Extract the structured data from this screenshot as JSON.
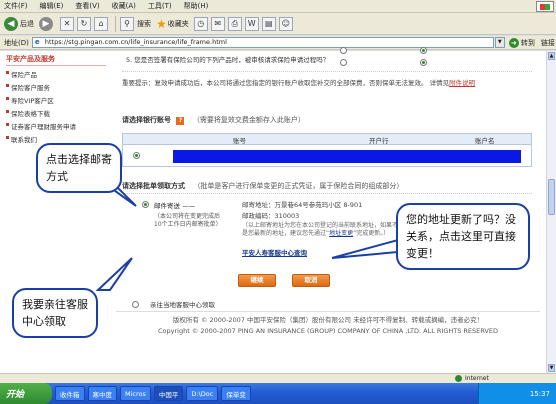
{
  "browser": {
    "menu": [
      "文件(F)",
      "编辑(E)",
      "查看(V)",
      "收藏(A)",
      "工具(T)",
      "帮助(H)"
    ],
    "toolbar": {
      "back_label": "后退",
      "search_label": "搜索",
      "favorites_label": "收藏夹"
    },
    "address_label": "地址(D)",
    "address_url": "https://stg.pingan.com.cn/life_insurance/life_frame.html",
    "go_label": "转到",
    "links_label": "链接"
  },
  "sidebar": {
    "title": "平安产品及服务",
    "items": [
      {
        "label": "保险产品"
      },
      {
        "label": "保险客户服务"
      },
      {
        "label": "寿险VIP客户区"
      },
      {
        "label": "保险表格下载"
      },
      {
        "label": "证券客户理财服务申请"
      },
      {
        "label": "联系我们"
      }
    ]
  },
  "form": {
    "question_5": "5. 您是否签署有保险公司的下列产品时，被审核请求保险申请过程吗？",
    "notice_text": "重要提示：复效申请成功后，本公司将通过您指定的银行账户收取您补交的全部保费，否则保单无法复效。",
    "notice_details": "详情见",
    "notice_link": "附件说明",
    "bank_section_title": "请选择银行账号",
    "bank_section_note": "（需要将复效交费金额存入此账户）",
    "bank_table": {
      "headers": [
        "账号",
        "开户行",
        "账户名"
      ]
    },
    "receive_section_title": "请选择批单领取方式",
    "receive_section_note": "（批单是客户进行保单变更的正式凭证，属于保险合同的组成部分）",
    "option_mail": {
      "label": "邮件寄送 ——",
      "desc": "（本公司将在变更完成后10个工作日内邮寄批单）",
      "address_label": "邮寄地址：",
      "address_value": "万景巷64号参苑玛小区 8-901",
      "zip_label": "邮政编码：",
      "zip_value": "310003",
      "hint": "（以上邮寄地址为您在本公司登记的当前联系地址，如果不是您最新的地址，建议您先通过“",
      "change_link": "地址变更",
      "hint_end": "”完成更新。）"
    },
    "option_counter": {
      "label": "亲往当地客服中心领取",
      "query_link": "平安人寿客服中心查询"
    },
    "continue_button": "继续",
    "cancel_button": "取消"
  },
  "callouts": {
    "mail": "点击选择邮寄方式",
    "counter": "我要亲往客服中心领取",
    "address": "您的地址更新了吗？没关系，点击这里可直接变更！"
  },
  "footer": {
    "line1": "版权所有 © 2000-2007 中国平安保险（集团）股份有限公司 未经许可不得复制、转载或摘编，违者必究！",
    "line2": "Copyright © 2000-2007 PING AN INSURANCE (GROUP) COMPANY OF CHINA ,LTD. ALL RIGHTS RESERVED"
  },
  "statusbar": {
    "zone": "Internet"
  },
  "taskbar": {
    "start": "开始",
    "tasks": [
      "收件箱",
      "寒中度",
      "Micros",
      "中国平",
      "D:\\Doc",
      "保单变"
    ],
    "time": "15:37"
  }
}
